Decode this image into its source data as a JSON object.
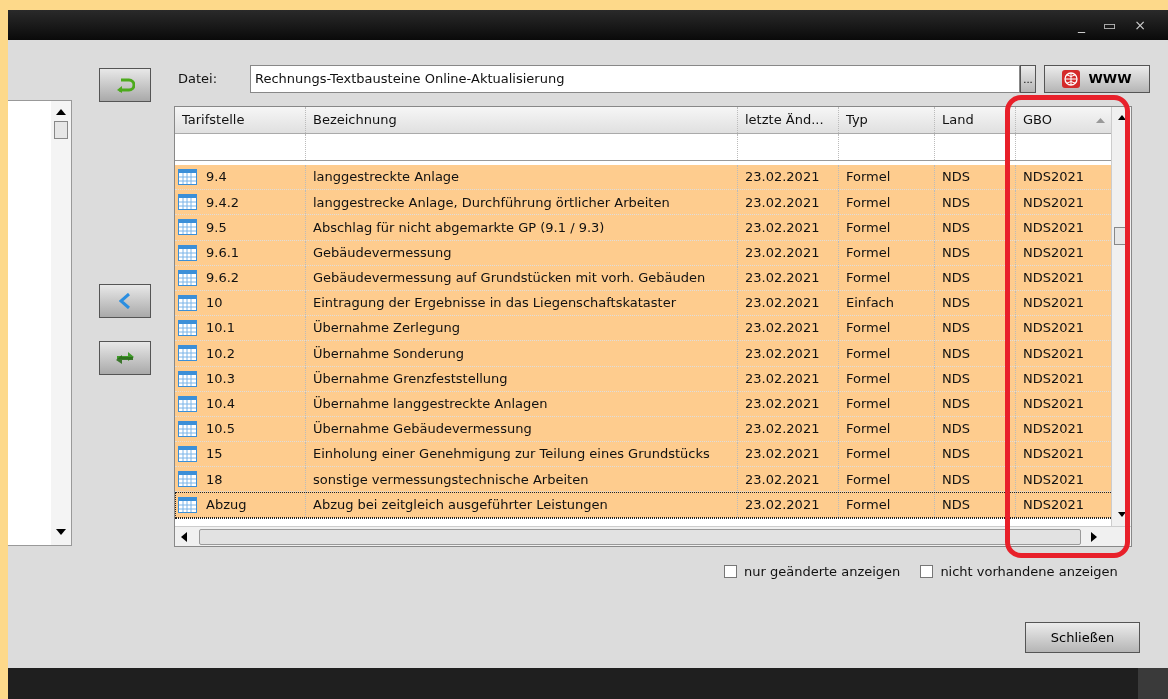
{
  "window": {
    "controls": [
      "_",
      "▭",
      "×"
    ]
  },
  "file": {
    "label": "Datei:",
    "value": "Rechnungs-Textbausteine Online-Aktualisierung",
    "browse": "...",
    "web_button": "WWW"
  },
  "table": {
    "columns": [
      {
        "label": "Tarifstelle",
        "sorted": false
      },
      {
        "label": "Bezeichnung",
        "sorted": false
      },
      {
        "label": "letzte Änd...",
        "sorted": false
      },
      {
        "label": "Typ",
        "sorted": false
      },
      {
        "label": "Land",
        "sorted": false
      },
      {
        "label": "GBO",
        "sorted": true
      }
    ],
    "rows": [
      {
        "cells": [
          "9.4",
          "langgestreckte Anlage",
          "23.02.2021",
          "Formel",
          "NDS",
          "NDS2021"
        ],
        "focused": false
      },
      {
        "cells": [
          "9.4.2",
          "langgestrecke Anlage, Durchführung örtlicher Arbeiten",
          "23.02.2021",
          "Formel",
          "NDS",
          "NDS2021"
        ],
        "focused": false
      },
      {
        "cells": [
          "9.5",
          "Abschlag für nicht abgemarkte GP (9.1 / 9.3)",
          "23.02.2021",
          "Formel",
          "NDS",
          "NDS2021"
        ],
        "focused": false
      },
      {
        "cells": [
          "9.6.1",
          "Gebäudevermessung",
          "23.02.2021",
          "Formel",
          "NDS",
          "NDS2021"
        ],
        "focused": false
      },
      {
        "cells": [
          "9.6.2",
          "Gebäudevermessung auf Grundstücken mit vorh. Gebäuden",
          "23.02.2021",
          "Formel",
          "NDS",
          "NDS2021"
        ],
        "focused": false
      },
      {
        "cells": [
          "10",
          "Eintragung der Ergebnisse in das Liegenschaftskataster",
          "23.02.2021",
          "Einfach",
          "NDS",
          "NDS2021"
        ],
        "focused": false
      },
      {
        "cells": [
          "10.1",
          "Übernahme Zerlegung",
          "23.02.2021",
          "Formel",
          "NDS",
          "NDS2021"
        ],
        "focused": false
      },
      {
        "cells": [
          "10.2",
          "Übernahme Sonderung",
          "23.02.2021",
          "Formel",
          "NDS",
          "NDS2021"
        ],
        "focused": false
      },
      {
        "cells": [
          "10.3",
          "Übernahme Grenzfeststellung",
          "23.02.2021",
          "Formel",
          "NDS",
          "NDS2021"
        ],
        "focused": false
      },
      {
        "cells": [
          "10.4",
          "Übernahme langgestreckte Anlagen",
          "23.02.2021",
          "Formel",
          "NDS",
          "NDS2021"
        ],
        "focused": false
      },
      {
        "cells": [
          "10.5",
          "Übernahme Gebäudevermessung",
          "23.02.2021",
          "Formel",
          "NDS",
          "NDS2021"
        ],
        "focused": false
      },
      {
        "cells": [
          "15",
          "Einholung einer Genehmigung zur Teilung eines Grundstücks",
          "23.02.2021",
          "Formel",
          "NDS",
          "NDS2021"
        ],
        "focused": false
      },
      {
        "cells": [
          "18",
          "sonstige vermessungstechnische Arbeiten",
          "23.02.2021",
          "Formel",
          "NDS",
          "NDS2021"
        ],
        "focused": false
      },
      {
        "cells": [
          "Abzug",
          "Abzug bei zeitgleich ausgeführter Leistungen",
          "23.02.2021",
          "Formel",
          "NDS",
          "NDS2021"
        ],
        "focused": true
      }
    ]
  },
  "options": [
    {
      "label": "nur geänderte anzeigen",
      "checked": false
    },
    {
      "label": "nicht vorhandene anzeigen",
      "checked": false
    }
  ],
  "close_button": "Schließen"
}
